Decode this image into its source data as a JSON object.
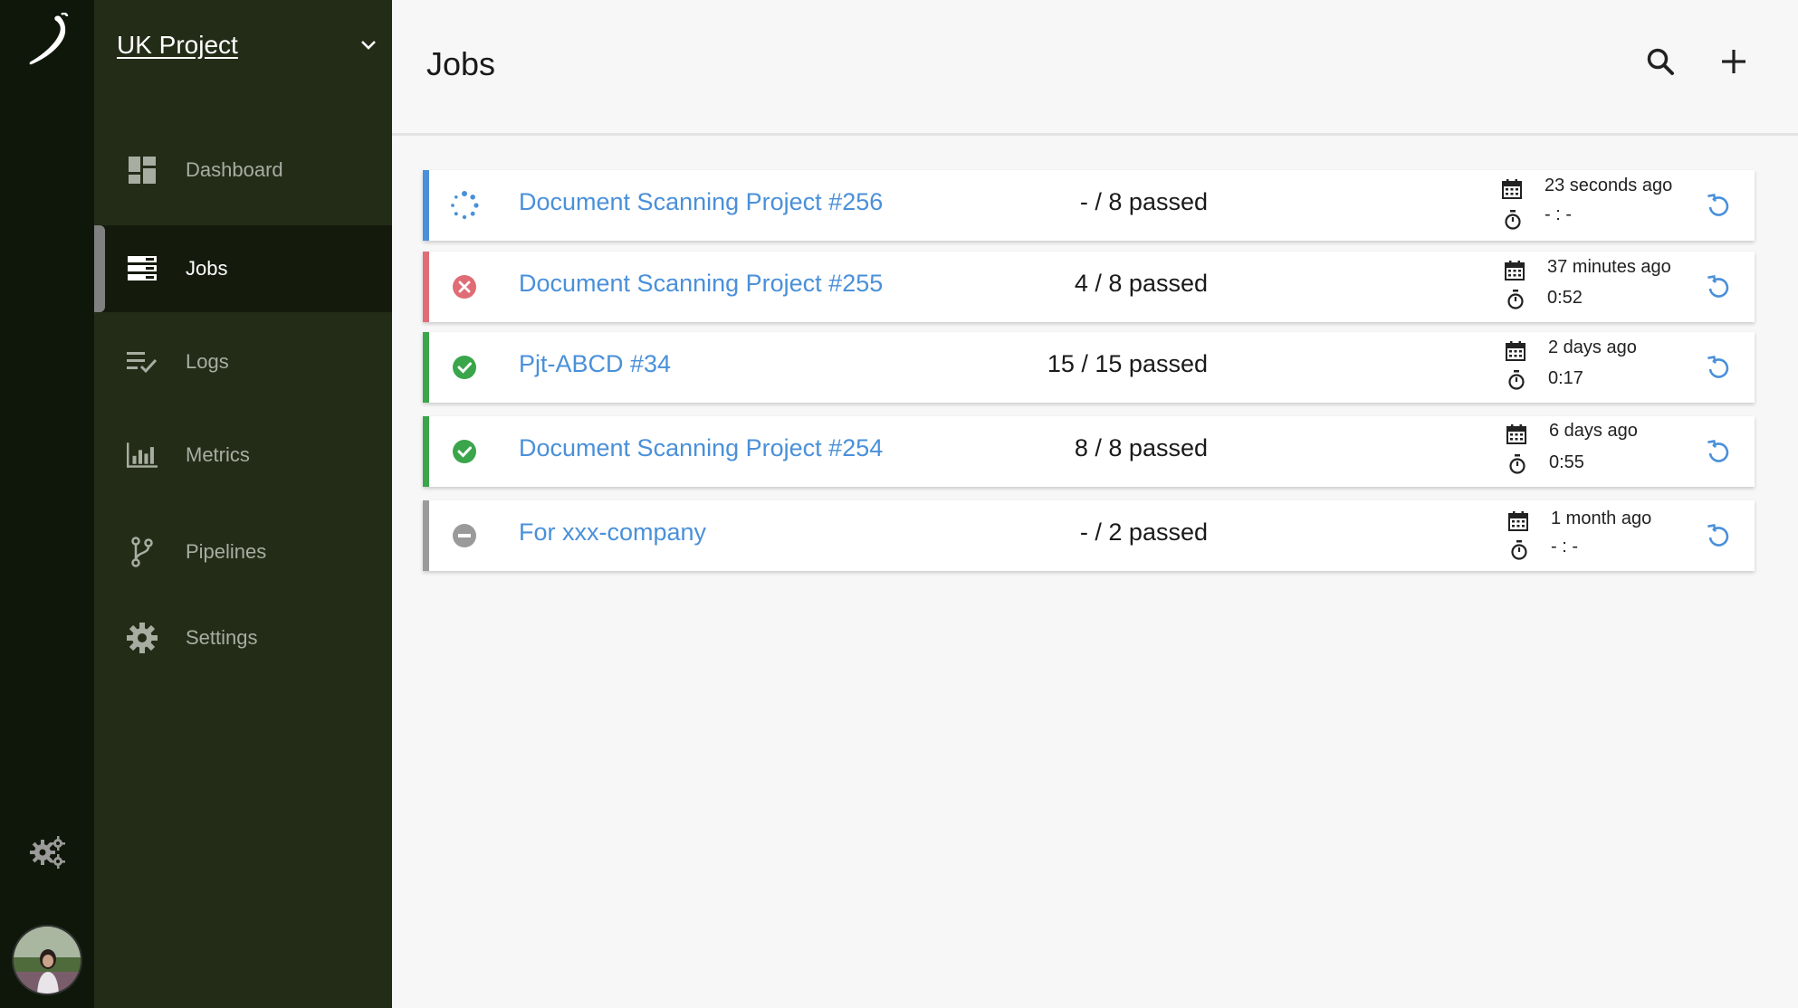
{
  "app": {
    "project_name": "UK Project"
  },
  "sidebar": {
    "items": [
      {
        "label": "Dashboard",
        "icon": "dashboard-icon"
      },
      {
        "label": "Jobs",
        "icon": "jobs-icon",
        "active": true
      },
      {
        "label": "Logs",
        "icon": "logs-icon"
      },
      {
        "label": "Metrics",
        "icon": "metrics-icon"
      },
      {
        "label": "Pipelines",
        "icon": "pipelines-icon"
      },
      {
        "label": "Settings",
        "icon": "settings-icon"
      }
    ]
  },
  "header": {
    "title": "Jobs",
    "search_icon": "search-icon",
    "add_icon": "plus-icon"
  },
  "jobs": [
    {
      "name": "Document Scanning Project #256",
      "passed": "- / 8 passed",
      "when": "23 seconds ago",
      "duration": "- : -",
      "status": "running"
    },
    {
      "name": "Document Scanning Project #255",
      "passed": "4 / 8 passed",
      "when": "37 minutes ago",
      "duration": "0:52",
      "status": "failed"
    },
    {
      "name": "Pjt-ABCD #34",
      "passed": "15  / 15 passed",
      "when": "2 days ago",
      "duration": "0:17",
      "status": "success"
    },
    {
      "name": "Document Scanning Project #254",
      "passed": "8 / 8 passed",
      "when": "6 days ago",
      "duration": "0:55",
      "status": "success"
    },
    {
      "name": "For xxx-company",
      "passed": "- / 2 passed",
      "when": "1 month ago",
      "duration": "- : -",
      "status": "cancelled"
    }
  ],
  "colors": {
    "running": "#4a90d9",
    "failed": "#e06c75",
    "success": "#3aa54a",
    "cancelled": "#9a9a9a",
    "link": "#4a90d9",
    "sidebar_bg": "#232c17",
    "rail_bg": "#0f170a"
  }
}
